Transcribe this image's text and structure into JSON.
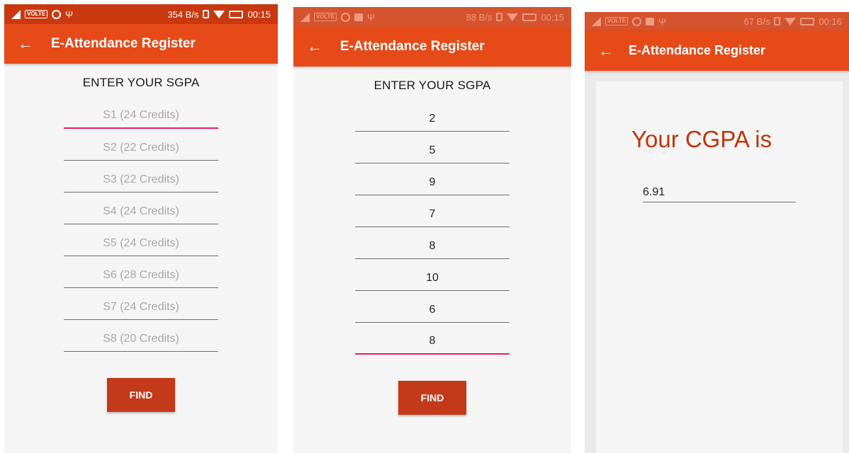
{
  "app": {
    "title": "E-Attendance Register",
    "back_icon": "←"
  },
  "screens": [
    {
      "status": {
        "speed": "354 B/s",
        "time": "00:15",
        "network": "VOLTE"
      },
      "heading": "ENTER YOUR SGPA",
      "fields": [
        {
          "placeholder": "S1 (24 Credits)",
          "value": ""
        },
        {
          "placeholder": "S2 (22 Credits)",
          "value": ""
        },
        {
          "placeholder": "S3 (22 Credits)",
          "value": ""
        },
        {
          "placeholder": "S4 (24 Credits)",
          "value": ""
        },
        {
          "placeholder": "S5 (24 Credits)",
          "value": ""
        },
        {
          "placeholder": "S6 (28 Credits)",
          "value": ""
        },
        {
          "placeholder": "S7 (24 Credits)",
          "value": ""
        },
        {
          "placeholder": "S8 (20 Credits)",
          "value": ""
        }
      ],
      "focused_field": 0,
      "button": "FIND"
    },
    {
      "status": {
        "speed": "88 B/s",
        "time": "00:15",
        "network": "VOLTE"
      },
      "heading": "ENTER YOUR SGPA",
      "fields": [
        {
          "value": "2"
        },
        {
          "value": "5"
        },
        {
          "value": "9"
        },
        {
          "value": "7"
        },
        {
          "value": "8"
        },
        {
          "value": "10"
        },
        {
          "value": "6"
        },
        {
          "value": "8"
        }
      ],
      "focused_field": 7,
      "button": "FIND"
    },
    {
      "status": {
        "speed": "67 B/s",
        "time": "00:16",
        "network": "VOLTE"
      },
      "result_title": "Your CGPA is",
      "result_value": "6.91"
    }
  ],
  "colors": {
    "primary": "#e64a19",
    "status_bar": "#c9380f",
    "button": "#c4391a",
    "focus_underline": "#e91e63",
    "result_text": "#bf360c"
  }
}
